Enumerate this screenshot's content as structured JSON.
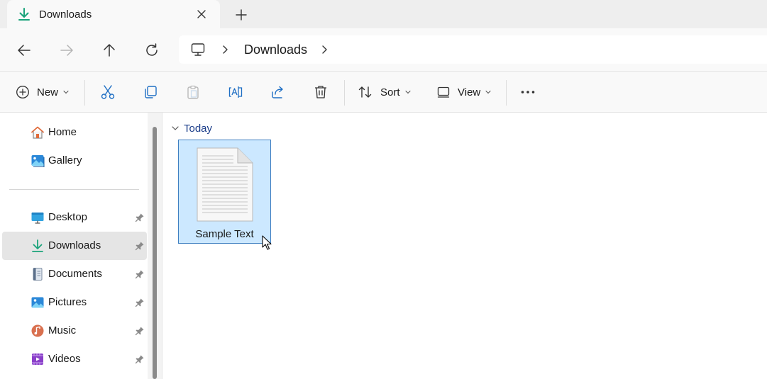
{
  "tab": {
    "title": "Downloads"
  },
  "address": {
    "crumb": "Downloads"
  },
  "toolbar": {
    "new_label": "New",
    "sort_label": "Sort",
    "view_label": "View"
  },
  "sidebar": {
    "items": [
      {
        "label": "Home",
        "icon": "home-icon",
        "pinned": false
      },
      {
        "label": "Gallery",
        "icon": "gallery-icon",
        "pinned": false
      },
      {
        "label": "Desktop",
        "icon": "desktop-icon",
        "pinned": true
      },
      {
        "label": "Downloads",
        "icon": "download-icon",
        "pinned": true,
        "selected": true
      },
      {
        "label": "Documents",
        "icon": "documents-icon",
        "pinned": true
      },
      {
        "label": "Pictures",
        "icon": "pictures-icon",
        "pinned": true
      },
      {
        "label": "Music",
        "icon": "music-icon",
        "pinned": true
      },
      {
        "label": "Videos",
        "icon": "videos-icon",
        "pinned": true
      }
    ]
  },
  "content": {
    "group_label": "Today",
    "files": [
      {
        "name": "Sample Text",
        "icon": "text-document-icon",
        "selected": true
      }
    ]
  },
  "colors": {
    "accent_green": "#1aa37a",
    "selection_fill": "#cce8ff",
    "selection_border": "#3f7fc1",
    "group_header": "#1b3d8a"
  }
}
